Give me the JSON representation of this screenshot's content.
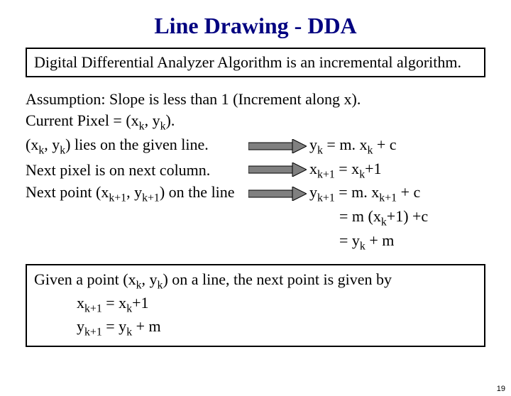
{
  "title": "Line Drawing - DDA",
  "box1": "Digital Differential Analyzer Algorithm is an incremental algorithm.",
  "assumption": "Assumption:  Slope is less than 1  (Increment along x).",
  "current_pixel_prefix": "Current Pixel = (x",
  "k": "k",
  "comma_y": ", y",
  "close_paren_dot": ").",
  "line3_left_a": "(x",
  "line3_left_b": ", y",
  "line3_left_c": ") lies on the given line.",
  "line3_right_a": "y",
  "line3_right_b": " =  m. x",
  "line3_right_c": " + c",
  "line4_left": "Next pixel is on next column.",
  "line4_right_a": "x",
  "kp1": "k+1",
  "line4_right_b": " = x",
  "line4_right_c": "+1",
  "line5_left_a": "Next point (x",
  "line5_left_b": ", y",
  "line5_left_c": ") on the line",
  "line5_right_a": " y",
  "line5_right_b": " =  m. x",
  "line5_right_c": " + c",
  "line6_a": "= m (x",
  "line6_b": "+1) +c",
  "line7_a": "= y",
  "line7_b": " + m",
  "box2_l1_a": "Given a point (x",
  "box2_l1_b": ", y",
  "box2_l1_c": ")  on a line,  the next point is given by",
  "box2_l2_a": "x",
  "box2_l2_b": " = x",
  "box2_l2_c": "+1",
  "box2_l3_a": "y",
  "box2_l3_b": " = y",
  "box2_l3_c": " + m",
  "pagenum": "19"
}
